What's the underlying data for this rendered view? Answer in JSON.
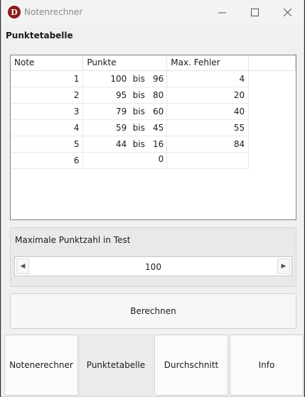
{
  "window": {
    "title": "Notenrechner",
    "icon_letter": "D"
  },
  "section_title": "Punktetabelle",
  "table": {
    "headers": [
      "Note",
      "Punkte",
      "Max. Fehler"
    ],
    "rows": [
      {
        "note": "1",
        "from": "100",
        "sep": "bis",
        "to": "96",
        "fehler": "4"
      },
      {
        "note": "2",
        "from": "95",
        "sep": "bis",
        "to": "80",
        "fehler": "20"
      },
      {
        "note": "3",
        "from": "79",
        "sep": "bis",
        "to": "60",
        "fehler": "40"
      },
      {
        "note": "4",
        "from": "59",
        "sep": "bis",
        "to": "45",
        "fehler": "55"
      },
      {
        "note": "5",
        "from": "44",
        "sep": "bis",
        "to": "16",
        "fehler": "84"
      },
      {
        "note": "6",
        "from": "",
        "sep": "",
        "to": "0",
        "fehler": ""
      }
    ]
  },
  "max_points": {
    "label": "Maximale Punktzahl in Test",
    "value": "100"
  },
  "calculate_label": "Berechnen",
  "tabs": [
    {
      "label": "Notenerechner",
      "active": false
    },
    {
      "label": "Punktetabelle",
      "active": true
    },
    {
      "label": "Durchschnitt",
      "active": false
    },
    {
      "label": "Info",
      "active": false
    }
  ]
}
